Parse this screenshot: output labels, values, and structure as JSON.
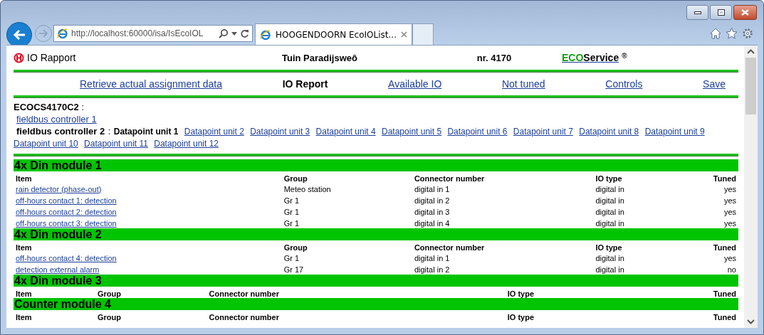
{
  "browser": {
    "address": "http://localhost:60000/isa/IsEcoIOL",
    "tabs": [
      {
        "title": "HOOGENDOORN EcoIOList...",
        "selected": true
      },
      {
        "selected": false
      }
    ]
  },
  "header": {
    "title": "IO Rapport",
    "location": "Tuin Paradijsweô",
    "number": "nr. 4170",
    "brand": {
      "eco": "ECO",
      "service": "Service",
      "mark": "®"
    }
  },
  "nav": [
    {
      "label": "Retrieve actual assignment data",
      "selected": false
    },
    {
      "label": "IO Report",
      "selected": true
    },
    {
      "label": "Available IO",
      "selected": false
    },
    {
      "label": "Not tuned",
      "selected": false
    },
    {
      "label": "Controls",
      "selected": false
    },
    {
      "label": "Save",
      "selected": false
    }
  ],
  "controller": {
    "name": "ECOCS4170C2",
    "separator": ":"
  },
  "fieldbus": [
    {
      "label": "fieldbus controller 1",
      "selected": false
    },
    {
      "label": "fieldbus controller 2",
      "selected": true,
      "separator": ":",
      "units": [
        {
          "label": "Datapoint unit 1",
          "selected": true
        },
        {
          "label": "Datapoint unit 2",
          "selected": false
        },
        {
          "label": "Datapoint unit 3",
          "selected": false
        },
        {
          "label": "Datapoint unit 4",
          "selected": false
        },
        {
          "label": "Datapoint unit 5",
          "selected": false
        },
        {
          "label": "Datapoint unit 6",
          "selected": false
        },
        {
          "label": "Datapoint unit 7",
          "selected": false
        },
        {
          "label": "Datapoint unit 8",
          "selected": false
        },
        {
          "label": "Datapoint unit 9",
          "selected": false
        },
        {
          "label": "Datapoint unit 10",
          "selected": false
        },
        {
          "label": "Datapoint unit 11",
          "selected": false
        },
        {
          "label": "Datapoint unit 12",
          "selected": false
        }
      ]
    }
  ],
  "modules": [
    {
      "title": "4x Din module 1",
      "columns": [
        "Item",
        "Group",
        "Connector number",
        "IO type",
        "Tuned"
      ],
      "rows": [
        [
          "rain detector (phase-out)",
          "Meteo station",
          "digital in 1",
          "digital in",
          "yes"
        ],
        [
          "off-hours contact 1: detection",
          "Gr 1",
          "digital in 2",
          "digital in",
          "yes"
        ],
        [
          "off-hours contact 2: detection",
          "Gr 1",
          "digital in 3",
          "digital in",
          "yes"
        ],
        [
          "off-hours contact 3: detection",
          "Gr 1",
          "digital in 4",
          "digital in",
          "yes"
        ]
      ]
    },
    {
      "title": "4x Din module 2",
      "columns": [
        "Item",
        "Group",
        "Connector number",
        "IO type",
        "Tuned"
      ],
      "rows": [
        [
          "off-hours contact 4: detection",
          "Gr 1",
          "digital in 1",
          "digital in",
          "yes"
        ],
        [
          "detection external alarm",
          "Gr 17",
          "digital in 2",
          "digital in",
          "no"
        ]
      ]
    },
    {
      "title": "4x Din module 3",
      "columns": [
        "Item",
        "Group",
        "Connector number",
        "IO type",
        "Tuned"
      ]
    },
    {
      "title": "Counter module 4",
      "columns": [
        "Item",
        "Group",
        "Connector number",
        "IO type",
        "Tuned"
      ]
    }
  ]
}
